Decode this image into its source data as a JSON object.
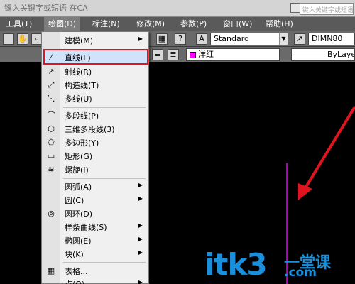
{
  "titlebar": {
    "title": "键入关键字或短语  在CA",
    "search_placeholder": "键入关键字或短语"
  },
  "menu": {
    "items": [
      "工具(T)",
      "绘图(D)",
      "标注(N)",
      "修改(M)",
      "参数(P)",
      "窗口(W)",
      "帮助(H)"
    ],
    "active": "绘图(D)"
  },
  "toolbar": {
    "text_style": "Standard",
    "dim_style": "DIMN80",
    "color": "洋红",
    "color_hex": "#ff00ff",
    "linetype": "ByLaye"
  },
  "draw_menu": {
    "items": [
      {
        "label": "建模(M)",
        "icon": "",
        "submenu": true
      },
      {
        "label": "直线(L)",
        "icon": "line-icon",
        "submenu": false,
        "highlighted": true
      },
      {
        "label": "射线(R)",
        "icon": "ray-icon",
        "submenu": false
      },
      {
        "label": "构造线(T)",
        "icon": "xline-icon",
        "submenu": false
      },
      {
        "label": "多线(U)",
        "icon": "mline-icon",
        "submenu": false
      },
      {
        "label": "多段线(P)",
        "icon": "polyline-icon",
        "submenu": false
      },
      {
        "label": "三维多段线(3)",
        "icon": "3dpoly-icon",
        "submenu": false
      },
      {
        "label": "多边形(Y)",
        "icon": "polygon-icon",
        "submenu": false
      },
      {
        "label": "矩形(G)",
        "icon": "rectangle-icon",
        "submenu": false
      },
      {
        "label": "螺旋(I)",
        "icon": "helix-icon",
        "submenu": false
      },
      {
        "label": "圆弧(A)",
        "icon": "",
        "submenu": true
      },
      {
        "label": "圆(C)",
        "icon": "",
        "submenu": true
      },
      {
        "label": "圆环(D)",
        "icon": "donut-icon",
        "submenu": false
      },
      {
        "label": "样条曲线(S)",
        "icon": "",
        "submenu": true
      },
      {
        "label": "椭圆(E)",
        "icon": "",
        "submenu": true
      },
      {
        "label": "块(K)",
        "icon": "",
        "submenu": true
      },
      {
        "label": "表格...",
        "icon": "table-icon",
        "submenu": false
      },
      {
        "label": "点(O)",
        "icon": "",
        "submenu": true
      }
    ]
  },
  "watermark": {
    "main": "itk3",
    "cn": "一堂课",
    "domain": ".com"
  },
  "colors": {
    "accent_highlight": "#e0141e",
    "arrow": "#e0141e",
    "line_magenta": "#b000b8",
    "watermark_blue": "#1a8fdc"
  }
}
